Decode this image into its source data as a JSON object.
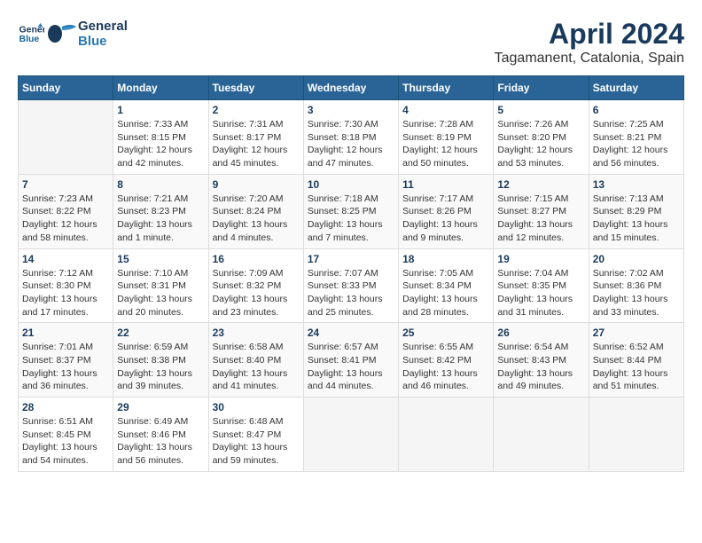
{
  "header": {
    "logo_line1": "General",
    "logo_line2": "Blue",
    "title": "April 2024",
    "subtitle": "Tagamanent, Catalonia, Spain"
  },
  "columns": [
    "Sunday",
    "Monday",
    "Tuesday",
    "Wednesday",
    "Thursday",
    "Friday",
    "Saturday"
  ],
  "weeks": [
    [
      {
        "day": "",
        "text": ""
      },
      {
        "day": "1",
        "text": "Sunrise: 7:33 AM\nSunset: 8:15 PM\nDaylight: 12 hours and 42 minutes."
      },
      {
        "day": "2",
        "text": "Sunrise: 7:31 AM\nSunset: 8:17 PM\nDaylight: 12 hours and 45 minutes."
      },
      {
        "day": "3",
        "text": "Sunrise: 7:30 AM\nSunset: 8:18 PM\nDaylight: 12 hours and 47 minutes."
      },
      {
        "day": "4",
        "text": "Sunrise: 7:28 AM\nSunset: 8:19 PM\nDaylight: 12 hours and 50 minutes."
      },
      {
        "day": "5",
        "text": "Sunrise: 7:26 AM\nSunset: 8:20 PM\nDaylight: 12 hours and 53 minutes."
      },
      {
        "day": "6",
        "text": "Sunrise: 7:25 AM\nSunset: 8:21 PM\nDaylight: 12 hours and 56 minutes."
      }
    ],
    [
      {
        "day": "7",
        "text": "Sunrise: 7:23 AM\nSunset: 8:22 PM\nDaylight: 12 hours and 58 minutes."
      },
      {
        "day": "8",
        "text": "Sunrise: 7:21 AM\nSunset: 8:23 PM\nDaylight: 13 hours and 1 minute."
      },
      {
        "day": "9",
        "text": "Sunrise: 7:20 AM\nSunset: 8:24 PM\nDaylight: 13 hours and 4 minutes."
      },
      {
        "day": "10",
        "text": "Sunrise: 7:18 AM\nSunset: 8:25 PM\nDaylight: 13 hours and 7 minutes."
      },
      {
        "day": "11",
        "text": "Sunrise: 7:17 AM\nSunset: 8:26 PM\nDaylight: 13 hours and 9 minutes."
      },
      {
        "day": "12",
        "text": "Sunrise: 7:15 AM\nSunset: 8:27 PM\nDaylight: 13 hours and 12 minutes."
      },
      {
        "day": "13",
        "text": "Sunrise: 7:13 AM\nSunset: 8:29 PM\nDaylight: 13 hours and 15 minutes."
      }
    ],
    [
      {
        "day": "14",
        "text": "Sunrise: 7:12 AM\nSunset: 8:30 PM\nDaylight: 13 hours and 17 minutes."
      },
      {
        "day": "15",
        "text": "Sunrise: 7:10 AM\nSunset: 8:31 PM\nDaylight: 13 hours and 20 minutes."
      },
      {
        "day": "16",
        "text": "Sunrise: 7:09 AM\nSunset: 8:32 PM\nDaylight: 13 hours and 23 minutes."
      },
      {
        "day": "17",
        "text": "Sunrise: 7:07 AM\nSunset: 8:33 PM\nDaylight: 13 hours and 25 minutes."
      },
      {
        "day": "18",
        "text": "Sunrise: 7:05 AM\nSunset: 8:34 PM\nDaylight: 13 hours and 28 minutes."
      },
      {
        "day": "19",
        "text": "Sunrise: 7:04 AM\nSunset: 8:35 PM\nDaylight: 13 hours and 31 minutes."
      },
      {
        "day": "20",
        "text": "Sunrise: 7:02 AM\nSunset: 8:36 PM\nDaylight: 13 hours and 33 minutes."
      }
    ],
    [
      {
        "day": "21",
        "text": "Sunrise: 7:01 AM\nSunset: 8:37 PM\nDaylight: 13 hours and 36 minutes."
      },
      {
        "day": "22",
        "text": "Sunrise: 6:59 AM\nSunset: 8:38 PM\nDaylight: 13 hours and 39 minutes."
      },
      {
        "day": "23",
        "text": "Sunrise: 6:58 AM\nSunset: 8:40 PM\nDaylight: 13 hours and 41 minutes."
      },
      {
        "day": "24",
        "text": "Sunrise: 6:57 AM\nSunset: 8:41 PM\nDaylight: 13 hours and 44 minutes."
      },
      {
        "day": "25",
        "text": "Sunrise: 6:55 AM\nSunset: 8:42 PM\nDaylight: 13 hours and 46 minutes."
      },
      {
        "day": "26",
        "text": "Sunrise: 6:54 AM\nSunset: 8:43 PM\nDaylight: 13 hours and 49 minutes."
      },
      {
        "day": "27",
        "text": "Sunrise: 6:52 AM\nSunset: 8:44 PM\nDaylight: 13 hours and 51 minutes."
      }
    ],
    [
      {
        "day": "28",
        "text": "Sunrise: 6:51 AM\nSunset: 8:45 PM\nDaylight: 13 hours and 54 minutes."
      },
      {
        "day": "29",
        "text": "Sunrise: 6:49 AM\nSunset: 8:46 PM\nDaylight: 13 hours and 56 minutes."
      },
      {
        "day": "30",
        "text": "Sunrise: 6:48 AM\nSunset: 8:47 PM\nDaylight: 13 hours and 59 minutes."
      },
      {
        "day": "",
        "text": ""
      },
      {
        "day": "",
        "text": ""
      },
      {
        "day": "",
        "text": ""
      },
      {
        "day": "",
        "text": ""
      }
    ]
  ]
}
